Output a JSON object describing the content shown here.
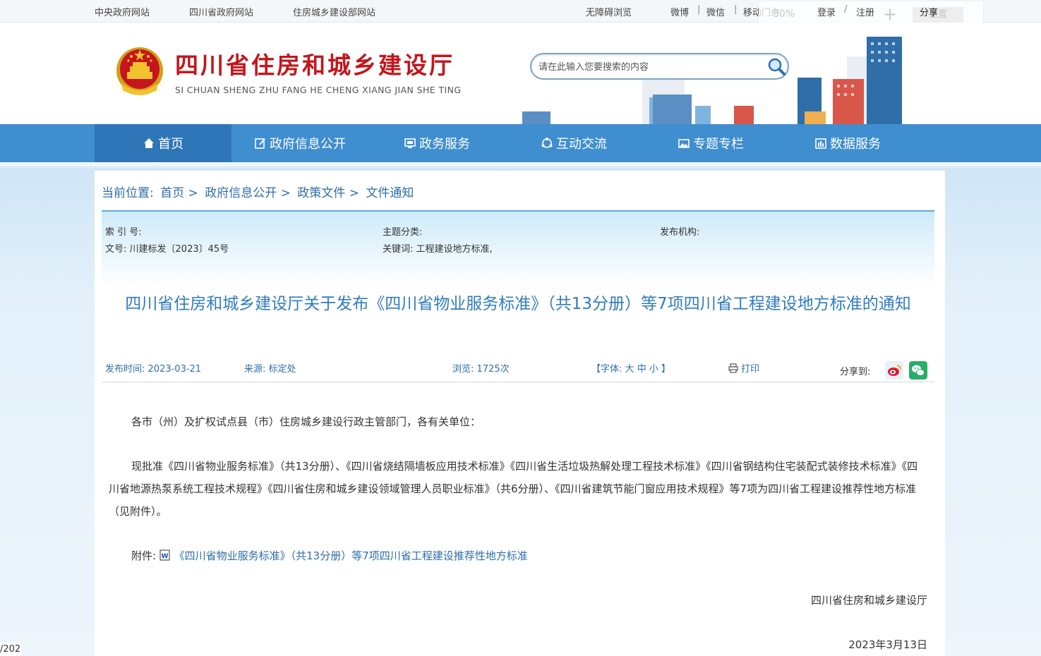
{
  "topbar": {
    "links": [
      "中央政府网站",
      "四川省政府网站",
      "住房城乡建设部网站"
    ],
    "accessibility": "无障碍浏览",
    "social": [
      "微博",
      "微信",
      "移动门户"
    ],
    "login": "登录",
    "slash": "/",
    "register": "注册",
    "share": "分享",
    "zoom_pct": "80%",
    "zoom_plus": "+",
    "zoom_reset": "重置"
  },
  "header": {
    "title": "四川省住房和城乡建设厅",
    "subtitle": "SI CHUAN SHENG ZHU FANG HE CHENG XIANG JIAN SHE TING",
    "search_placeholder": "请在此输入您要搜索的内容"
  },
  "nav": {
    "items": [
      "首页",
      "政府信息公开",
      "政务服务",
      "互动交流",
      "专题专栏",
      "数据服务"
    ],
    "active": "首页"
  },
  "breadcrumb": {
    "label": "当前位置:",
    "items": [
      "首页",
      "政府信息公开",
      "政策文件",
      "文件通知"
    ],
    "sep": ">"
  },
  "meta": {
    "index_label": "索 引 号:",
    "index_value": "",
    "topic_label": "主题分类:",
    "topic_value": "",
    "org_label": "发布机构:",
    "org_value": "",
    "docno_label": "文号:",
    "docno_value": "川建标发〔2023〕45号",
    "keywords_label": "关键词:",
    "keywords_value": "工程建设地方标准,"
  },
  "article": {
    "title": "四川省住房和城乡建设厅关于发布《四川省物业服务标准》（共13分册）等7项四川省工程建设地方标准的通知",
    "publish_label": "发布时间:",
    "publish_date": "2023-03-21",
    "source_label": "来源:",
    "source": "标定处",
    "views_label": "浏览:",
    "views": "1725次",
    "font_label": "【字体:",
    "font_sizes": [
      "大",
      "中",
      "小"
    ],
    "font_close": "】",
    "print": "打印",
    "share_to": "分享到:",
    "salutation": "各市（州）及扩权试点县（市）住房城乡建设行政主管部门，各有关单位：",
    "body": "现批准《四川省物业服务标准》（共13分册）、《四川省烧结隔墙板应用技术标准》《四川省生活垃圾热解处理工程技术标准》《四川省钢结构住宅装配式装修技术标准》《四川省地源热泵系统工程技术规程》《四川省住房和城乡建设领域管理人员职业标准》（共6分册）、《四川省建筑节能门窗应用技术规程》等7项为四川省工程建设推荐性地方标准（见附件）。",
    "attachment_label": "附件:",
    "attachment_link": "《四川省物业服务标准》（共13分册）等7项四川省工程建设推荐性地方标准",
    "signature": "四川省住房和城乡建设厅",
    "date": "2023年3月13日"
  },
  "pager_fragment": "/202",
  "colors": {
    "nav_bg": "#3f8ed0",
    "nav_active": "#2f76b8",
    "title_red": "#c4161c",
    "link_blue": "#2f6ea8",
    "heading_blue": "#2f7cc0"
  }
}
